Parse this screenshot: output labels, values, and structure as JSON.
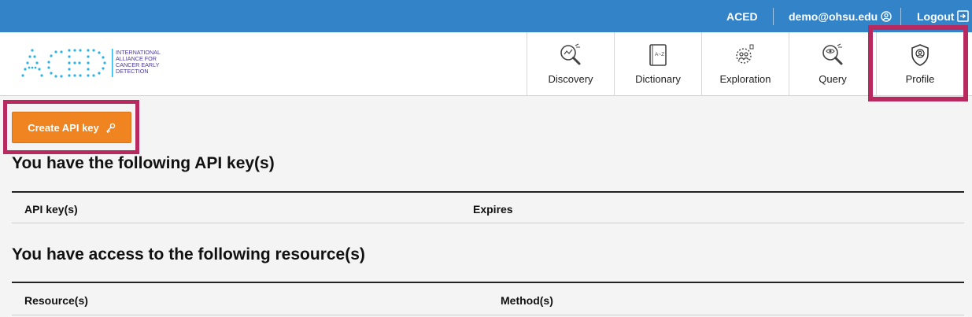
{
  "topbar": {
    "brand": "ACED",
    "user": "demo@ohsu.edu",
    "logout": "Logout",
    "user_icon": "user-circle-icon",
    "logout_icon": "logout-icon",
    "bg_color": "#3283c8"
  },
  "logo": {
    "wordmark": "ACED",
    "tagline": [
      "INTERNATIONAL",
      "ALLIANCE FOR",
      "CANCER EARLY",
      "DETECTION"
    ]
  },
  "nav": {
    "tabs": [
      {
        "label": "Discovery",
        "icon": "discovery-icon"
      },
      {
        "label": "Dictionary",
        "icon": "dictionary-icon"
      },
      {
        "label": "Exploration",
        "icon": "exploration-icon"
      },
      {
        "label": "Query",
        "icon": "query-icon"
      },
      {
        "label": "Profile",
        "icon": "profile-shield-icon",
        "active": true
      }
    ]
  },
  "actions": {
    "create_api_key": "Create API key",
    "create_icon": "key-icon",
    "button_color": "#ef8421"
  },
  "api_keys": {
    "title": "You have the following API key(s)",
    "columns": [
      "API key(s)",
      "Expires"
    ]
  },
  "resources": {
    "title": "You have access to the following resource(s)",
    "columns": [
      "Resource(s)",
      "Method(s)"
    ]
  },
  "highlight_color": "#b7295f"
}
